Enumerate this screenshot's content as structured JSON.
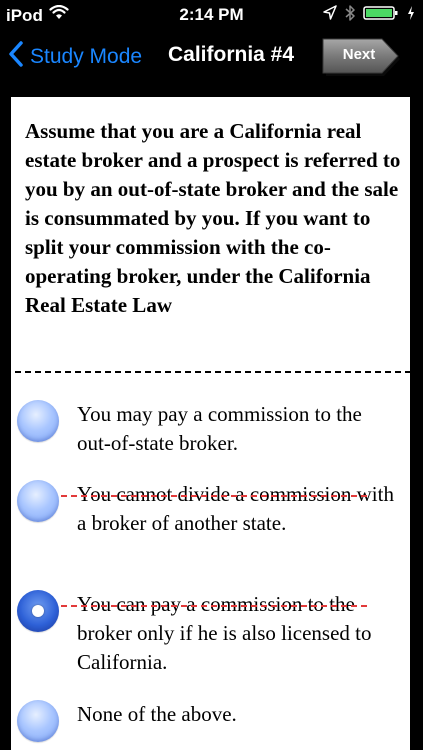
{
  "status_bar": {
    "carrier": "iPod",
    "time": "2:14 PM",
    "icons": [
      "wifi-icon",
      "location-icon",
      "bluetooth-icon",
      "battery-icon",
      "charging-icon"
    ],
    "battery_color": "#4cd964"
  },
  "nav": {
    "back_label": "Study Mode",
    "title": "California #4",
    "next_label": "Next",
    "accent_color": "#1a86ff"
  },
  "question": {
    "text": "Assume that you are a California real estate broker and a prospect is referred to you by an out-of-state broker and the sale is consummated by you. If you want to split your commission with the co-operating broker, under the California Real Estate Law"
  },
  "answers": [
    {
      "text": "You may pay a commission to the out-of-state broker.",
      "selected": false,
      "eliminated": false
    },
    {
      "text": "You cannot divide a commission with a broker of another state.",
      "selected": false,
      "eliminated": true
    },
    {
      "text": "You can pay a commission to the broker only if he is also licensed to California.",
      "selected": true,
      "eliminated": true
    },
    {
      "text": "None of the above.",
      "selected": false,
      "eliminated": false
    }
  ],
  "elimination_color": "#e23a3a"
}
